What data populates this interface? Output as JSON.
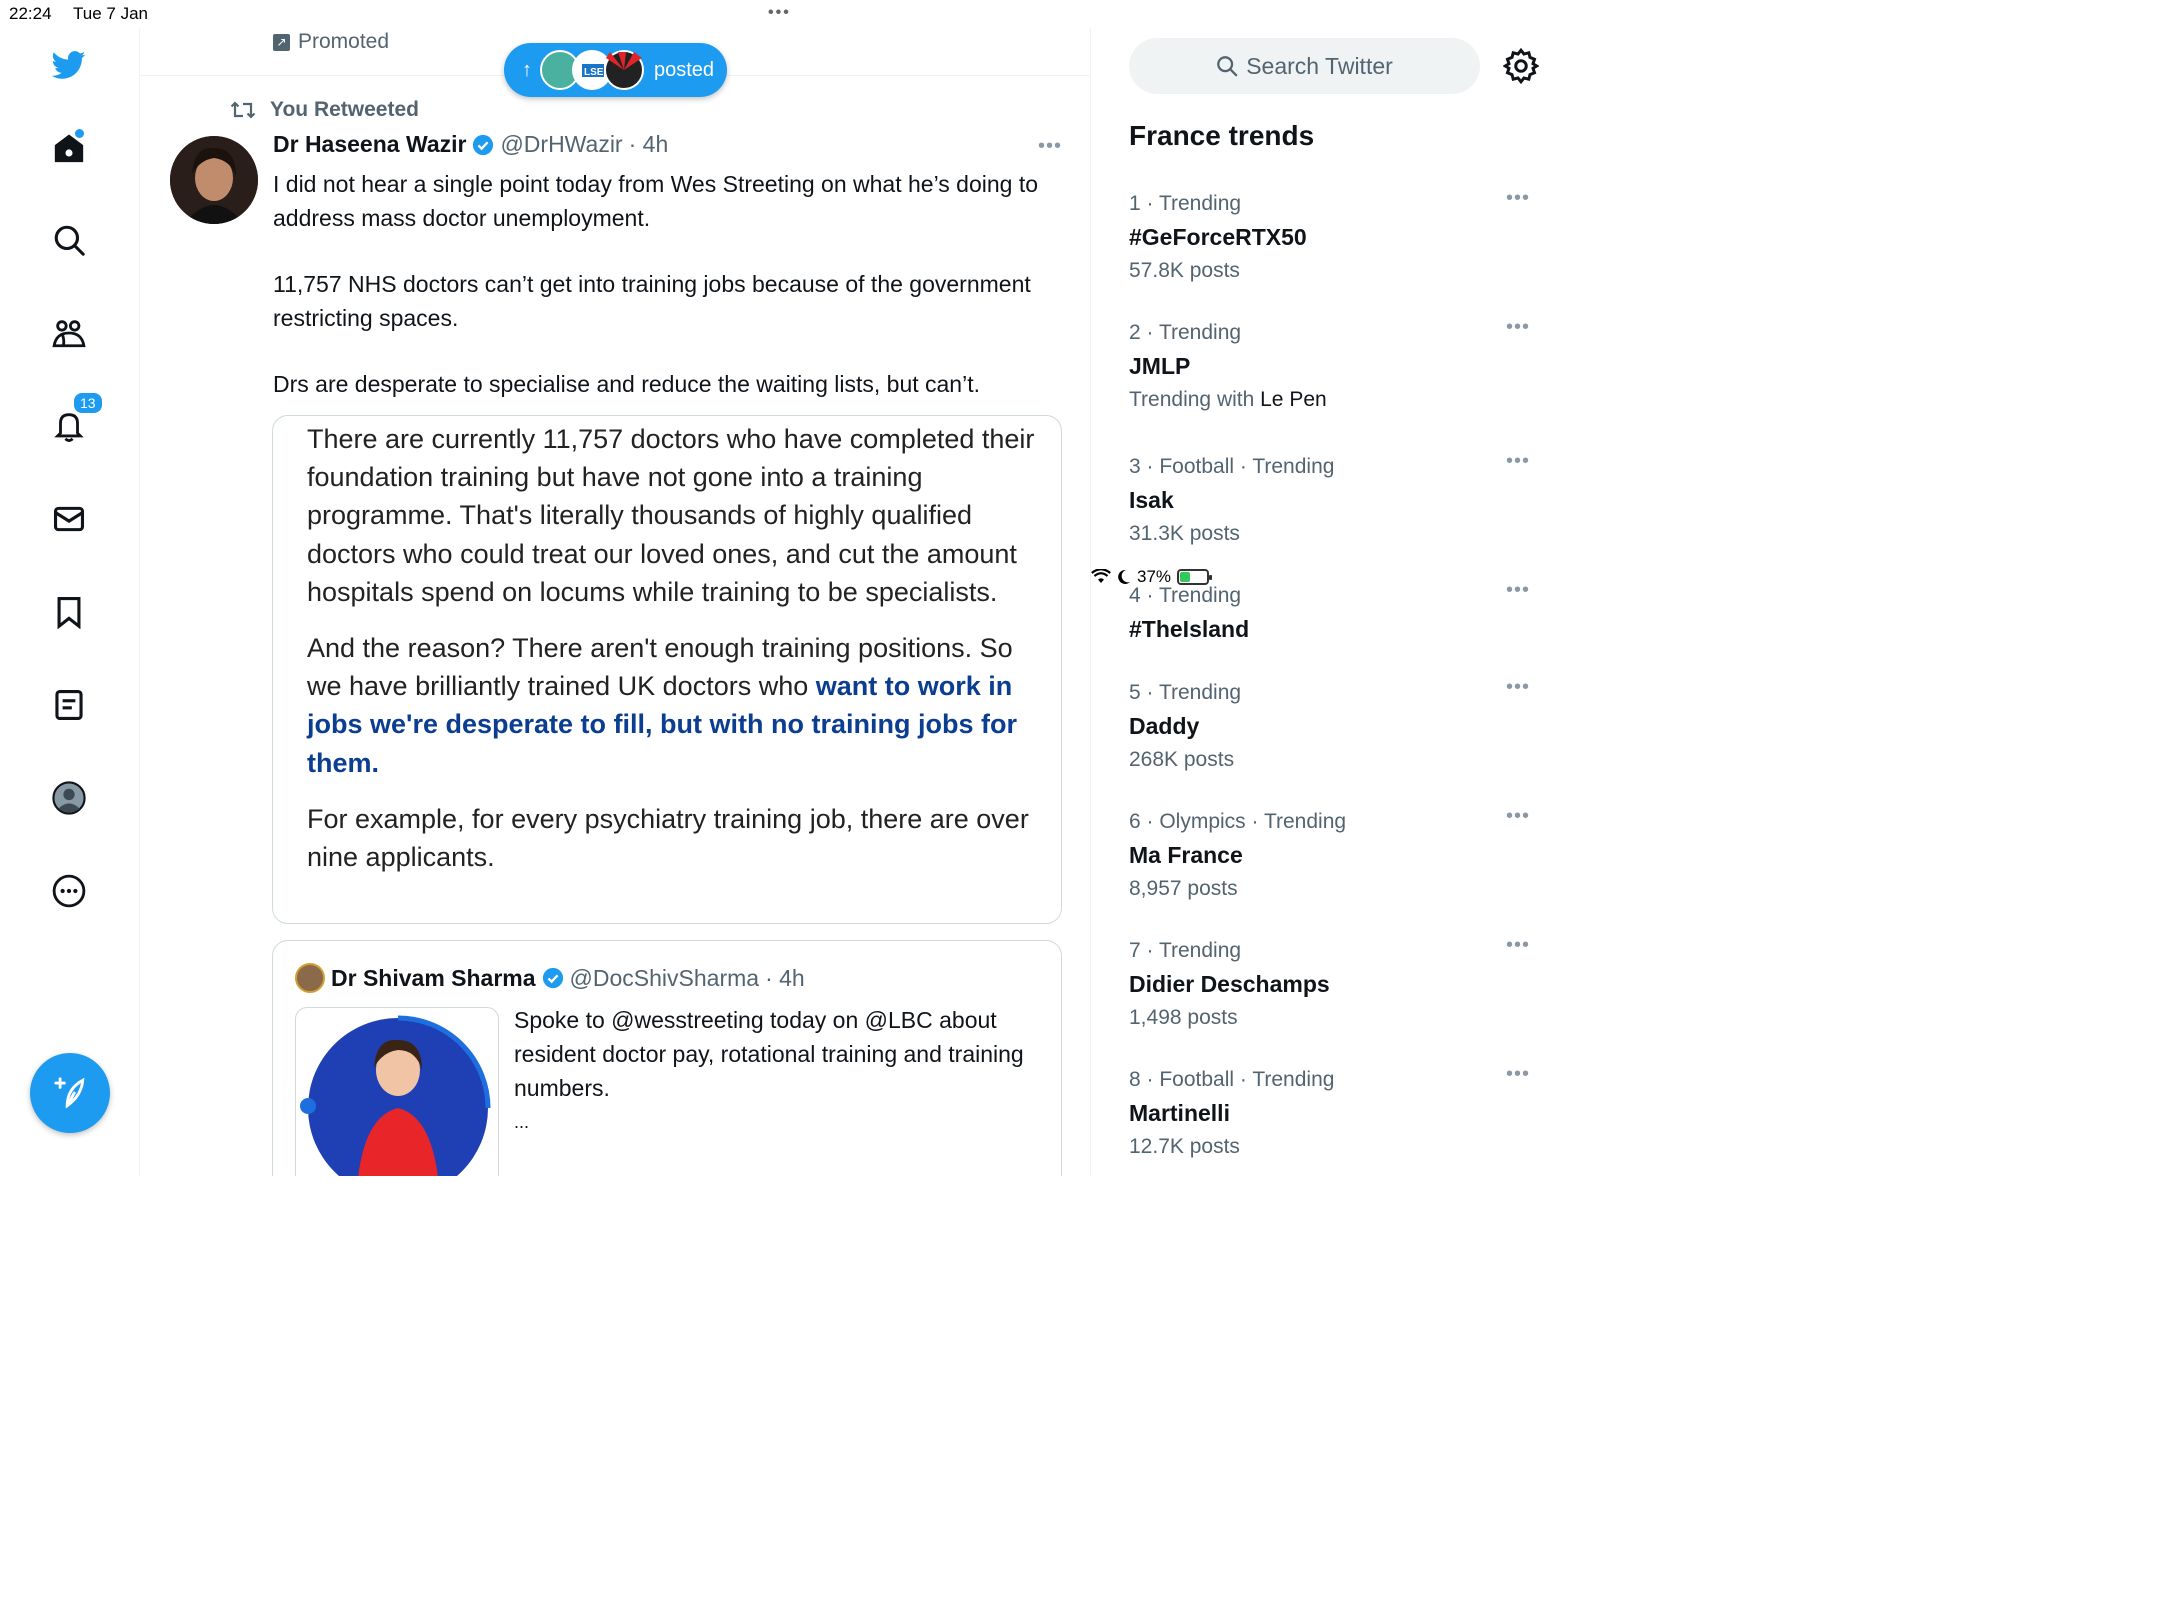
{
  "status_bar": {
    "time": "22:24",
    "date": "Tue 7 Jan",
    "battery": "37%",
    "battery_level": 0.37
  },
  "nav": {
    "notifications_badge": "13"
  },
  "feed": {
    "promoted_label": "Promoted",
    "posted_pill": {
      "label": "posted"
    },
    "retweet_label": "You Retweeted",
    "tweet": {
      "name": "Dr Haseena Wazir",
      "handle": "@DrHWazir",
      "time": "· 4h",
      "paragraphs": [
        "I did not hear a single point today from Wes Streeting on what he’s doing to address mass doctor unemployment.",
        "11,757 NHS doctors can’t get into training jobs because of the government restricting spaces.",
        "Drs are desperate to specialise and reduce the waiting lists, but can’t."
      ]
    },
    "quote_image": {
      "p1": "There are currently 11,757 doctors who have completed their foundation training but have not gone into a training programme. That's literally thousands of highly qualified doctors who could treat our loved ones, and cut the amount hospitals spend on locums while training to be specialists.",
      "p2_plain": "And the reason? There aren't enough training positions. So we have brilliantly trained UK doctors who ",
      "p2_bold": "want to work in jobs we're desperate to fill, but with no training jobs for them.",
      "p3": "For example, for every psychiatry training job, there are over nine applicants."
    },
    "quoted_tweet": {
      "name": "Dr Shivam Sharma",
      "handle": "@DocShivSharma",
      "time": "· 4h",
      "text": "Spoke to @wesstreeting today on @LBC about resident doctor pay, rotational training and training numbers.",
      "ellipsis": "..."
    }
  },
  "sidebar": {
    "search_placeholder": "Search Twitter",
    "trends_title": "France trends",
    "trends": [
      {
        "meta": "1 · Trending",
        "name": "#GeForceRTX50",
        "sub": "57.8K posts"
      },
      {
        "meta": "2 · Trending",
        "name": "JMLP",
        "sub_prefix": "Trending with ",
        "sub_highlight": "Le Pen"
      },
      {
        "meta": "3 · Football · Trending",
        "name": "Isak",
        "sub": "31.3K posts"
      },
      {
        "meta": "4 · Trending",
        "name": "#TheIsland"
      },
      {
        "meta": "5 · Trending",
        "name": "Daddy",
        "sub": "268K posts"
      },
      {
        "meta": "6 · Olympics · Trending",
        "name": "Ma France",
        "sub": "8,957 posts"
      },
      {
        "meta": "7 · Trending",
        "name": "Didier Deschamps",
        "sub": "1,498 posts"
      },
      {
        "meta": "8 · Football · Trending",
        "name": "Martinelli",
        "sub": "12.7K posts"
      }
    ]
  },
  "colors": {
    "accent": "#1d9bf0",
    "text": "#0f1419",
    "secondary": "#536471",
    "quote_highlight": "#0b3d91"
  },
  "icons": [
    "twitter-logo-icon",
    "home-icon",
    "search-icon",
    "communities-icon",
    "notifications-icon",
    "messages-icon",
    "bookmarks-icon",
    "lists-icon",
    "profile-icon",
    "more-icon",
    "compose-icon",
    "settings-icon",
    "retweet-icon",
    "verified-icon",
    "wifi-icon",
    "moon-icon",
    "battery-icon"
  ]
}
